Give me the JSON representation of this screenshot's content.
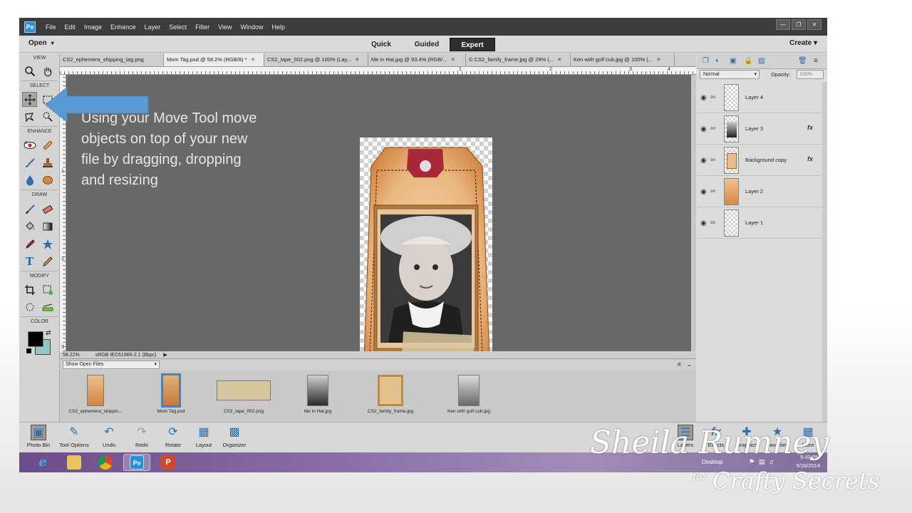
{
  "menubar": {
    "items": [
      "File",
      "Edit",
      "Image",
      "Enhance",
      "Layer",
      "Select",
      "Filter",
      "View",
      "Window",
      "Help"
    ]
  },
  "modebar": {
    "open_label": "Open",
    "tabs": [
      "Quick",
      "Guided",
      "Expert"
    ],
    "active_tab": "Expert",
    "create_label": "Create"
  },
  "tools": {
    "sections": [
      "VIEW",
      "SELECT",
      "ENHANCE",
      "DRAW",
      "MODIFY",
      "COLOR"
    ]
  },
  "doc_tabs": [
    {
      "label": "CS2_ephemera_shipping_tag.png",
      "closable": false
    },
    {
      "label": "Mom Tag.psd @ 58.2% (RGB/8) *",
      "closable": true
    },
    {
      "label": "CS2_tape_002.png @ 100% (Lay...",
      "closable": true
    },
    {
      "label": "Me in Hat.jpg @ 93.4% (RGB/...",
      "closable": true
    },
    {
      "label": "© CS2_family_frame.jpg @ 29% (...",
      "closable": true
    },
    {
      "label": "Ken with golf cub.jpg @ 100% (...",
      "closable": true
    }
  ],
  "ruler_labels": [
    "1",
    "2",
    "3",
    "4"
  ],
  "instruction": {
    "bullet": "•",
    "text": "Using your Move Tool move objects on top of your new file by dragging, dropping and resizing"
  },
  "status": {
    "zoom": "58.22%",
    "profile": "sRGB IEC61966-2.1 (8bpc)"
  },
  "photo_bin": {
    "filter_label": "Show Open Files",
    "files": [
      "CS2_ephemera_shippin...",
      "Mom Tag.psd",
      "CS2_tape_002.png",
      "Me in Hat.jpg",
      "CS2_family_frame.jpg",
      "Ken with golf cub.jpg"
    ]
  },
  "layers_panel": {
    "blend_mode": "Normal",
    "opacity_label": "Opacity:",
    "opacity_value": "100%",
    "layers": [
      {
        "name": "Layer 4",
        "fx": false
      },
      {
        "name": "Layer 3",
        "fx": true
      },
      {
        "name": "Background copy",
        "fx": true
      },
      {
        "name": "Layer 2",
        "fx": false
      },
      {
        "name": "Layer 1",
        "fx": false
      }
    ],
    "fx_label": "fx"
  },
  "bottom_bar": {
    "left": [
      "Photo Bin",
      "Tool Options",
      "Undo",
      "Redo",
      "Rotate",
      "Layout",
      "Organizer"
    ],
    "right": [
      "Layers",
      "Effects",
      "Graphics",
      "Favorites",
      "More"
    ]
  },
  "taskbar": {
    "desktop_label": "Desktop",
    "time": "5:42 PM",
    "date": "5/16/2014"
  },
  "watermark": {
    "name": "Sheila Rumney",
    "for": "for",
    "brand": "Crafty Secrets"
  },
  "colors": {
    "accent_blue": "#5b9bd5",
    "canvas_gray": "#686868",
    "tag_orange": "#d9893e"
  }
}
